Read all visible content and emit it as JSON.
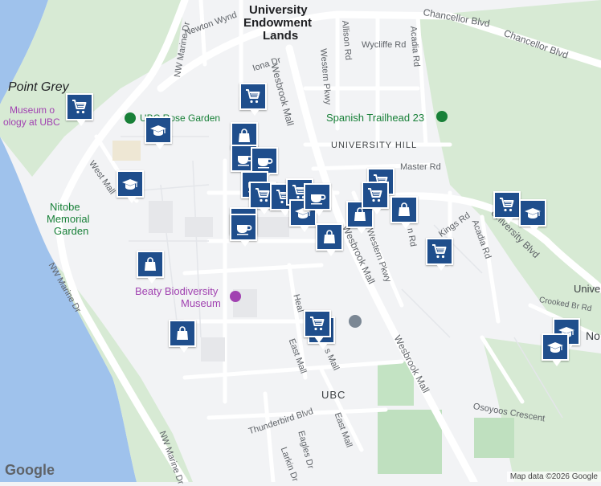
{
  "labels": {
    "uel_line1": "University",
    "uel_line2": "Endowment",
    "uel_line3": "Lands",
    "point_grey": "Point Grey",
    "museum1": "Museum o",
    "museum2": "ology at UBC",
    "rose_garden": "UBC Rose Garden",
    "nitobe1": "Nitobe",
    "nitobe2": "Memorial",
    "nitobe3": "Garden",
    "beaty1": "Beaty Biodiversity",
    "beaty2": "Museum",
    "spanish_trailhead": "Spanish Trailhead 23",
    "university_hill": "UNIVERSITY HILL",
    "ubc": "UBC",
    "no_partial": "No",
    "univ_partial": "Univer"
  },
  "roads": {
    "chancellor1": "Chancellor Blvd",
    "chancellor2": "Chancellor Blvd",
    "newton": "Newton Wynd",
    "nw_marine_top": "NW Marine Dr",
    "nw_marine_left": "NW Marine Dr",
    "nw_marine_bottom": "NW Marine Dr",
    "iona": "Iona Dr",
    "wesbrook_top": "Wesbrook Mall",
    "western_pkwy_top": "Western Pkwy",
    "allison": "Allison Rd",
    "wycliffe": "Wycliffe Rd",
    "acadia_top": "Acadia Rd",
    "master": "Master Rd",
    "west_mall": "West Mall",
    "wesbrook_mid": "Wesbrook Mall",
    "western_pkwy_mid": "Western Pkwy",
    "kings": "Kings Rd",
    "acadia_mid": "Acadia Rd",
    "university_blvd": "University Blvd",
    "crooked": "Crooked Br Rd",
    "wesbrook_low": "Wesbrook Mall",
    "east_mall1": "East Mall",
    "east_mall2": "East Mall",
    "heal": "Heal",
    "s_mall": "s Mall",
    "osoyoos": "Osoyoos Crescent",
    "thunderbird": "Thunderbird Blvd",
    "eagles": "Eagles Dr",
    "larkin": "Larkin Dr",
    "n_rd": "n Rd"
  },
  "markers": [
    {
      "icon": "cart"
    },
    {
      "icon": "cart"
    },
    {
      "icon": "school"
    },
    {
      "icon": "school"
    },
    {
      "icon": "bag"
    },
    {
      "icon": "coffee"
    },
    {
      "icon": "coffee"
    },
    {
      "icon": "coffee"
    },
    {
      "icon": "cart"
    },
    {
      "icon": "cart"
    },
    {
      "icon": "cart"
    },
    {
      "icon": "school"
    },
    {
      "icon": "coffee"
    },
    {
      "icon": "coffee"
    },
    {
      "icon": "coffee"
    },
    {
      "icon": "bag"
    },
    {
      "icon": "bag"
    },
    {
      "icon": "cart"
    },
    {
      "icon": "cart"
    },
    {
      "icon": "bag"
    },
    {
      "icon": "cart"
    },
    {
      "icon": "cart"
    },
    {
      "icon": "school"
    },
    {
      "icon": "bag"
    },
    {
      "icon": "bag"
    },
    {
      "icon": "school"
    },
    {
      "icon": "school"
    },
    {
      "icon": "school"
    },
    {
      "icon": "cart"
    }
  ],
  "branding": "Google",
  "attribution": "Map data ©2026 Google"
}
